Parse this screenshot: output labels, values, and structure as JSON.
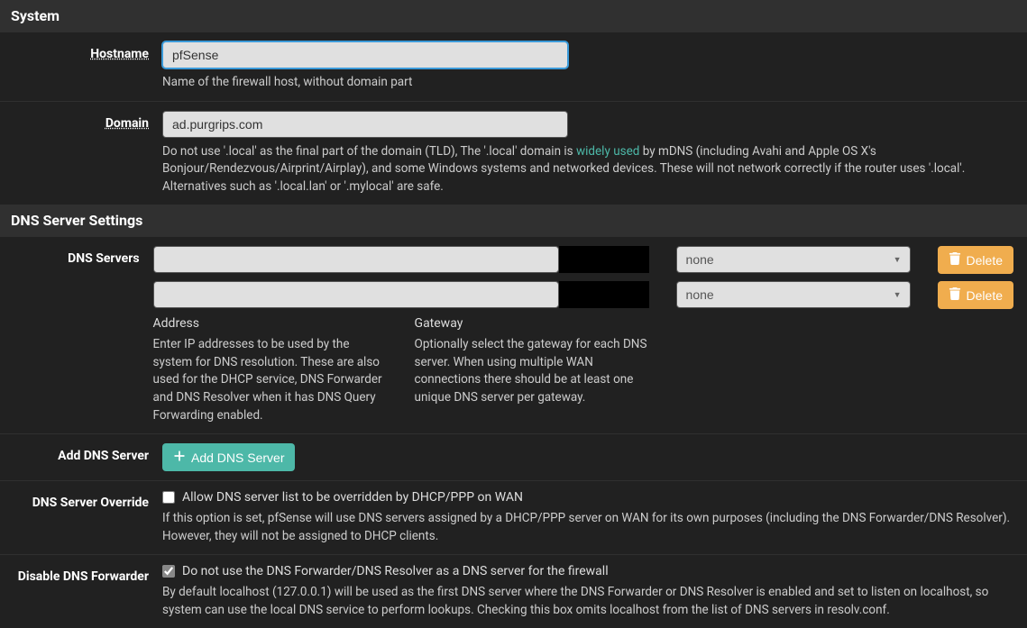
{
  "system": {
    "heading": "System",
    "hostname_label": "Hostname",
    "hostname_value": "pfSense",
    "hostname_help": "Name of the firewall host, without domain part",
    "domain_label": "Domain",
    "domain_value": "ad.purgrips.com",
    "domain_help_pre": "Do not use '.local' as the final part of the domain (TLD), The '.local' domain is ",
    "domain_help_link": "widely used",
    "domain_help_post": " by mDNS (including Avahi and Apple OS X's Bonjour/Rendezvous/Airprint/Airplay), and some Windows systems and networked devices. These will not network correctly if the router uses '.local'. Alternatives such as '.local.lan' or '.mylocal' are safe."
  },
  "dns": {
    "heading": "DNS Server Settings",
    "servers_label": "DNS Servers",
    "gateway_option": "none",
    "delete_label": "Delete",
    "address_sub": "Address",
    "address_help": "Enter IP addresses to be used by the system for DNS resolution. These are also used for the DHCP service, DNS Forwarder and DNS Resolver when it has DNS Query Forwarding enabled.",
    "gateway_sub": "Gateway",
    "gateway_help": "Optionally select the gateway for each DNS server. When using multiple WAN connections there should be at least one unique DNS server per gateway.",
    "add_label": "Add DNS Server",
    "add_button": "Add DNS Server",
    "override_label": "DNS Server Override",
    "override_checkbox_label": "Allow DNS server list to be overridden by DHCP/PPP on WAN",
    "override_help": "If this option is set, pfSense will use DNS servers assigned by a DHCP/PPP server on WAN for its own purposes (including the DNS Forwarder/DNS Resolver). However, they will not be assigned to DHCP clients.",
    "disable_label": "Disable DNS Forwarder",
    "disable_checkbox_label": "Do not use the DNS Forwarder/DNS Resolver as a DNS server for the firewall",
    "disable_checked": true,
    "disable_help": "By default localhost (127.0.0.1) will be used as the first DNS server where the DNS Forwarder or DNS Resolver is enabled and set to listen on localhost, so system can use the local DNS service to perform lookups. Checking this box omits localhost from the list of DNS servers in resolv.conf."
  }
}
